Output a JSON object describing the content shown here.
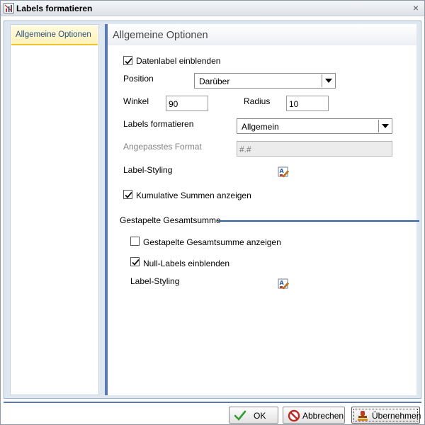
{
  "window": {
    "title": "Labels formatieren",
    "close_glyph": "×"
  },
  "nav": {
    "items": [
      {
        "label": "Allgemeine Optionen"
      }
    ]
  },
  "panel": {
    "title": "Allgemeine Optionen",
    "show_data_label": {
      "label": "Datenlabel einblenden",
      "checked": true
    },
    "position": {
      "label": "Position",
      "value": "Darüber"
    },
    "winkel": {
      "label": "Winkel",
      "value": "90"
    },
    "radius": {
      "label": "Radius",
      "value": "10"
    },
    "format_labels": {
      "label": "Labels formatieren",
      "value": "Allgemein"
    },
    "custom_format": {
      "label": "Angepasstes Format",
      "value": "#.#"
    },
    "label_styling": {
      "label": "Label-Styling"
    },
    "cumulative": {
      "label": "Kumulative Summen anzeigen",
      "checked": true
    },
    "stacked_section": {
      "title": "Gestapelte Gesamtsumme",
      "show_stacked": {
        "label": "Gestapelte Gesamtsumme anzeigen",
        "checked": false
      },
      "show_null": {
        "label": "Null-Labels einblenden",
        "checked": true
      },
      "label_styling": {
        "label": "Label-Styling"
      }
    }
  },
  "footer": {
    "ok": "OK",
    "cancel": "Abbrechen",
    "apply": "Übernehmen"
  },
  "colors": {
    "accent": "#5879b2",
    "nav_selected": "#fff3b8",
    "section_line": "#2d5fa6"
  }
}
